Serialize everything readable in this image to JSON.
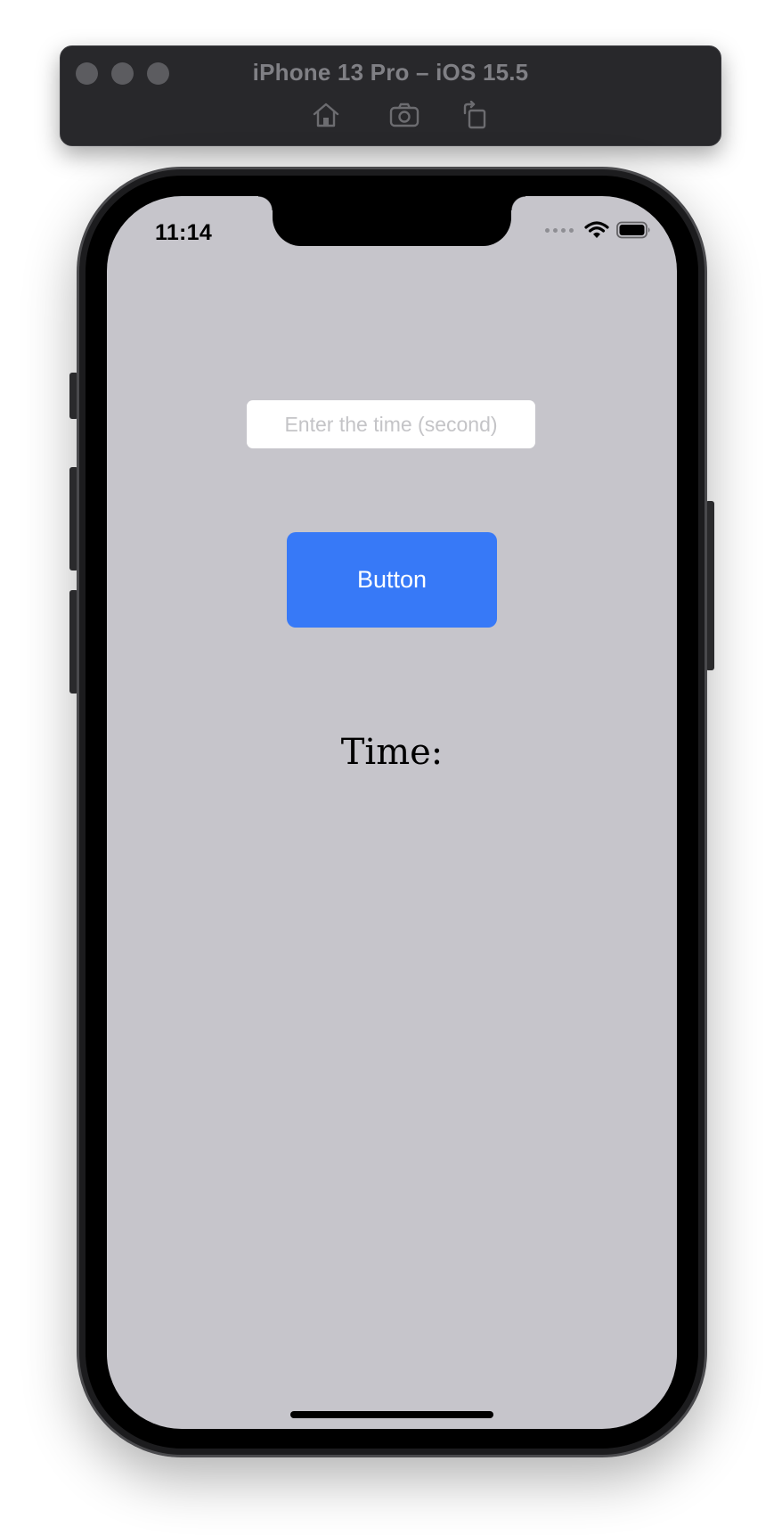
{
  "simulator": {
    "title": "iPhone 13 Pro – iOS 15.5",
    "toolbar_icons": [
      "home-icon",
      "screenshot-icon",
      "rotate-icon"
    ]
  },
  "status_bar": {
    "time": "11:14",
    "icons": [
      "cellular-signal-icon",
      "wifi-icon",
      "battery-icon"
    ]
  },
  "app": {
    "input": {
      "placeholder": "Enter the time (second)",
      "value": ""
    },
    "button_label": "Button",
    "time_label": "Time:"
  },
  "colors": {
    "screen_background": "#c6c5cb",
    "button_background": "#3779f7",
    "button_text": "#ffffff",
    "toolbar_background": "#28282b"
  }
}
